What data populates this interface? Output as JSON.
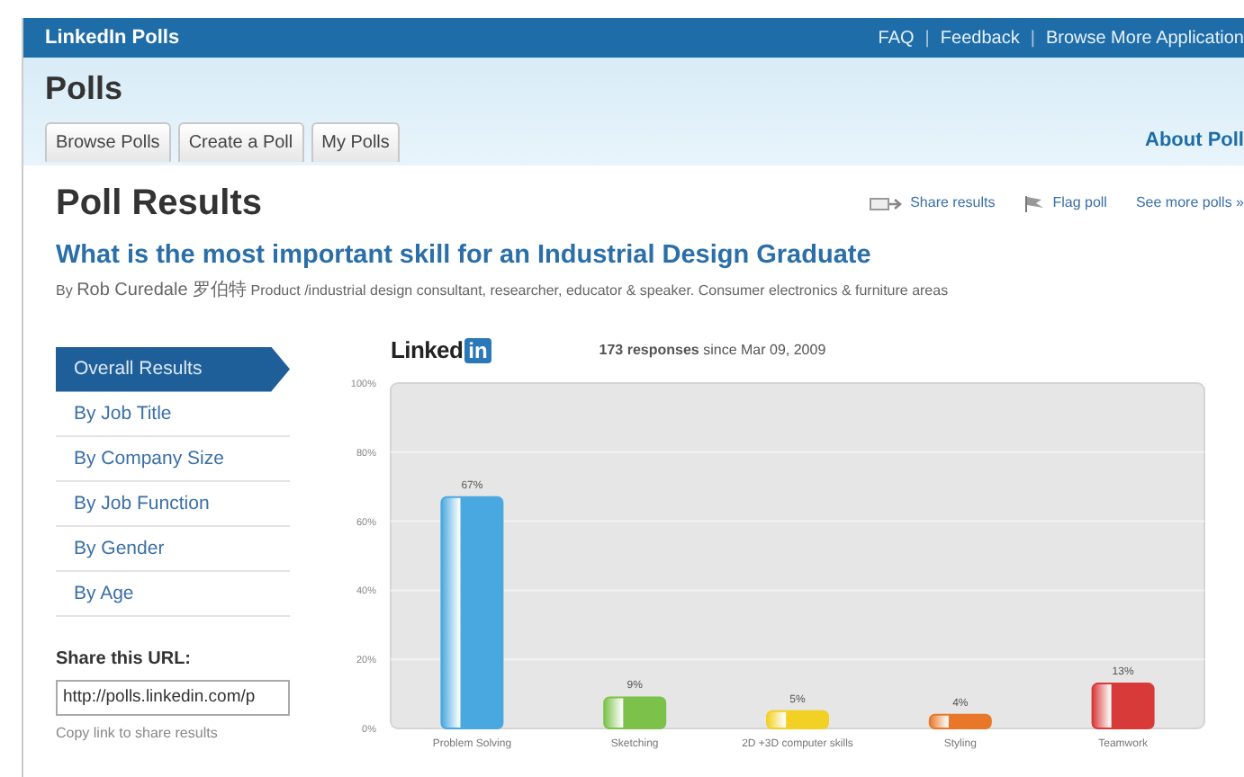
{
  "top_bar": {
    "title": "LinkedIn Polls",
    "links": [
      "FAQ",
      "Feedback",
      "Browse More Application"
    ],
    "separator": "|"
  },
  "header": {
    "title": "Polls",
    "tabs": [
      "Browse Polls",
      "Create a Poll",
      "My Polls"
    ],
    "about_link": "About Poll"
  },
  "results": {
    "title": "Poll Results",
    "actions": [
      {
        "kind": "share",
        "label": "Share results"
      },
      {
        "kind": "flag",
        "label": "Flag poll"
      },
      {
        "kind": "more",
        "label": "See more polls »"
      }
    ],
    "question": "What is the most important skill for an Industrial Design Graduate",
    "byline": {
      "prefix": "By",
      "author": "Rob Curedale 罗伯特",
      "bio": "Product /industrial design consultant, researcher, educator & speaker. Consumer electronics & furniture areas"
    }
  },
  "sidebar": {
    "items": [
      {
        "label": "Overall Results",
        "selected": true
      },
      {
        "label": "By Job Title",
        "selected": false
      },
      {
        "label": "By Company Size",
        "selected": false
      },
      {
        "label": "By Job Function",
        "selected": false
      },
      {
        "label": "By Gender",
        "selected": false
      },
      {
        "label": "By Age",
        "selected": false
      }
    ],
    "share_label": "Share this URL:",
    "share_url": "http://polls.linkedin.com/p",
    "share_hint": "Copy link to share results"
  },
  "chart": {
    "logo": {
      "word": "Linked",
      "badge": "in"
    },
    "responses": "173 responses",
    "since": "since Mar 09, 2009",
    "chart_data": {
      "type": "bar",
      "categories": [
        "Problem Solving",
        "Sketching",
        "2D +3D computer skills",
        "Styling",
        "Teamwork"
      ],
      "series": [
        {
          "values": [
            67,
            9,
            5,
            4,
            13
          ]
        }
      ],
      "colors": [
        "#4aa8e0",
        "#7cc24a",
        "#f2d024",
        "#e8772a",
        "#d83a3a"
      ],
      "ylim": [
        0,
        100
      ],
      "grid": true,
      "yticks": [
        {
          "value": 0,
          "label": "0%"
        },
        {
          "value": 20,
          "label": "20%"
        },
        {
          "value": 40,
          "label": "40%"
        },
        {
          "value": 60,
          "label": "60%"
        },
        {
          "value": 80,
          "label": "80%"
        },
        {
          "value": 100,
          "label": "100%"
        }
      ],
      "value_labels": [
        "67%",
        "9%",
        "5%",
        "4%",
        "13%"
      ]
    }
  }
}
